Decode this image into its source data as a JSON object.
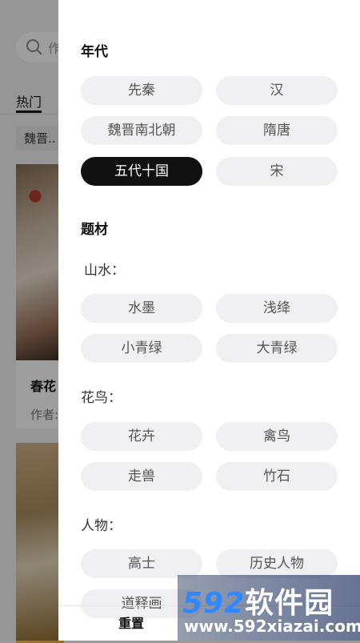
{
  "background": {
    "search_placeholder": "作",
    "tab_hot": "热门",
    "filter_chip": "魏晋..",
    "card_title": "春花",
    "card_author": "作者:"
  },
  "drawer": {
    "era": {
      "title": "年代",
      "options": [
        "先秦",
        "汉",
        "魏晋南北朝",
        "隋唐",
        "五代十国",
        "宋"
      ],
      "selected": "五代十国"
    },
    "subject": {
      "title": "题材",
      "groups": [
        {
          "label": "山水：",
          "options": [
            "水墨",
            "浅绛",
            "小青绿",
            "大青绿"
          ]
        },
        {
          "label": "花鸟：",
          "options": [
            "花卉",
            "禽鸟",
            "走兽",
            "竹石"
          ]
        },
        {
          "label": "人物：",
          "options": [
            "高士",
            "历史人物",
            "道释画"
          ]
        }
      ]
    },
    "footer": {
      "reset": "重置"
    }
  },
  "watermark": {
    "digits": "592",
    "brand": "软件园",
    "url": "www.592xiazai.com"
  },
  "colors": {
    "selected_pill_bg": "#111111",
    "pill_bg": "#f0f0f2",
    "watermark_blue": "#2f88ff"
  }
}
